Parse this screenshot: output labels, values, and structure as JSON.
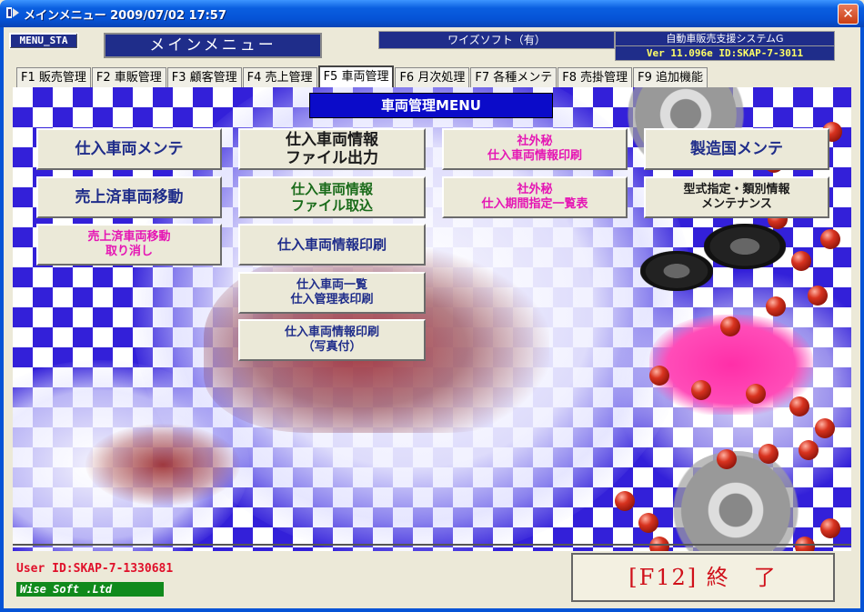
{
  "window": {
    "title": "メインメニュー 2009/07/02 17:57",
    "close_label": "✕"
  },
  "header": {
    "menu_code": "MENU_STA",
    "screen_title": "メインメニュー",
    "company": "ワイズソフト（有）",
    "system_name": "自動車販売支援システムG",
    "version": "Ver 11.096e  ID:SKAP-7-3011"
  },
  "tabs": [
    {
      "label": "F1 販売管理"
    },
    {
      "label": "F2 車販管理"
    },
    {
      "label": "F3 顧客管理"
    },
    {
      "label": "F4 売上管理"
    },
    {
      "label": "F5 車両管理"
    },
    {
      "label": "F6 月次処理"
    },
    {
      "label": "F7 各種メンテ"
    },
    {
      "label": "F8 売掛管理"
    },
    {
      "label": "F9 追加機能"
    }
  ],
  "active_tab_index": 4,
  "section": {
    "title": "車両管理MENU"
  },
  "buttons": {
    "purchase_vehicle_maint": "仕入車両メンテ",
    "sold_vehicle_move": "売上済車両移動",
    "sold_vehicle_move_cancel": "売上済車両移動\n取り消し",
    "purchase_info_file_out": "仕入車両情報\nファイル出力",
    "purchase_info_file_in": "仕入車両情報\nファイル取込",
    "purchase_info_print": "仕入車両情報印刷",
    "purchase_list_print": "仕入車両一覧\n仕入管理表印刷",
    "purchase_info_print_photo": "仕入車両情報印刷\n（写真付）",
    "confidential_info_print": "社外秘\n仕入車両情報印刷",
    "confidential_period_list": "社外秘\n仕入期間指定一覧表",
    "country_maint": "製造国メンテ",
    "model_spec_maint": "型式指定・類別情報\nメンテナンス"
  },
  "footer": {
    "user_id": "User ID:SKAP-7-1330681",
    "brand": "Wise Soft .Ltd",
    "exit_label": "[F12] 終　了"
  },
  "colors": {
    "navy_text": "#1f2d8a",
    "green_text": "#1a6b1a",
    "magenta_text": "#e516b4",
    "exit_red": "#d0101a",
    "checker_blue": "#3320d9"
  }
}
